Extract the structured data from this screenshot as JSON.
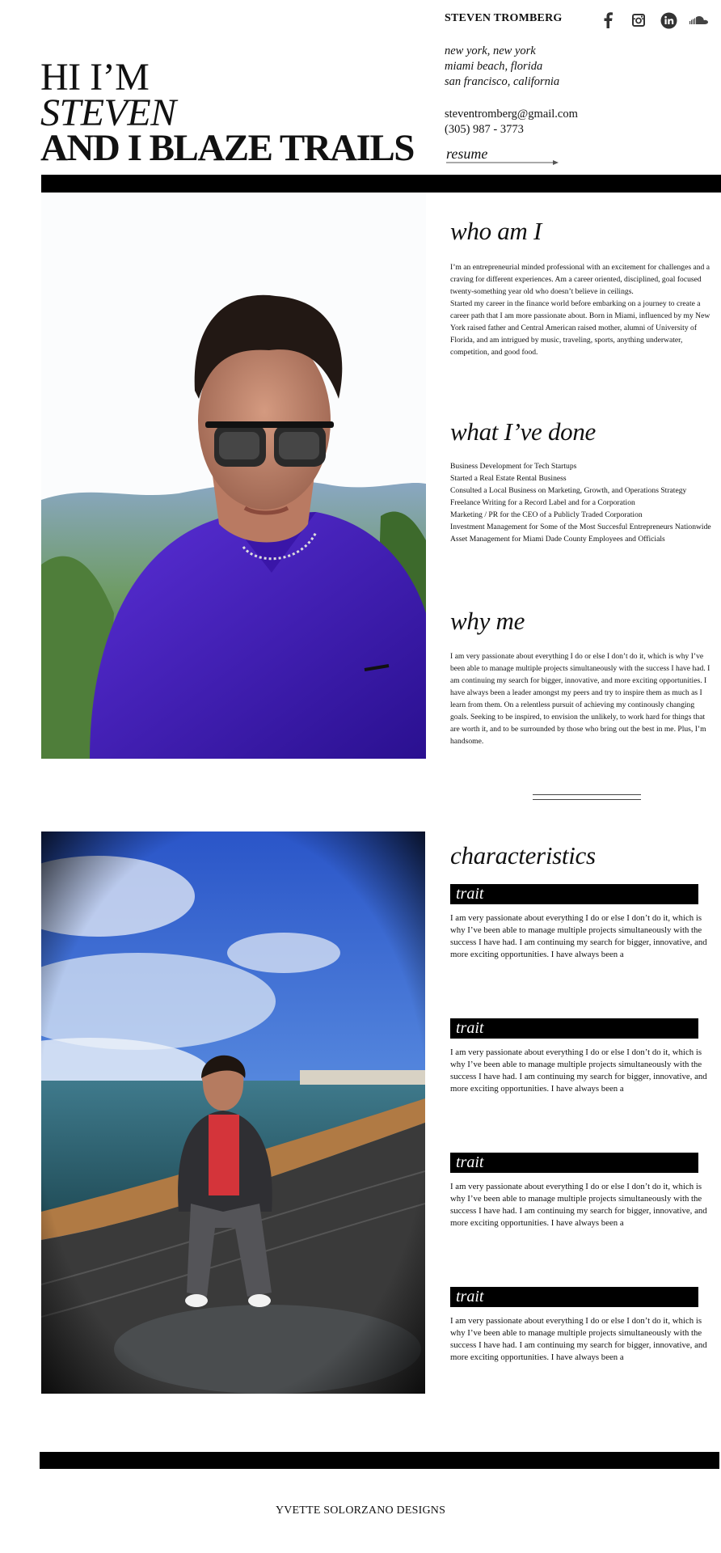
{
  "header": {
    "brand": "STEVEN TROMBERG",
    "social": [
      {
        "icon": "facebook-icon"
      },
      {
        "icon": "instagram-icon"
      },
      {
        "icon": "linkedin-icon"
      },
      {
        "icon": "soundcloud-icon"
      }
    ],
    "locations": [
      "new york, new york",
      "miami beach, florida",
      "san francisco, california"
    ],
    "email": "steventromberg@gmail.com",
    "phone": "(305) 987 - 3773",
    "resume_label": "resume"
  },
  "hero": {
    "line1": "HI I’M",
    "line2": "STEVEN",
    "line3": "AND I BLAZE TRAILS"
  },
  "sections": {
    "who": {
      "title": "who am I",
      "body": "I’m an entrepreneurial minded professional with an excitement for challenges and a craving for different experiences.  Am a career oriented, disciplined, goal focused twenty-something year old who doesn’t believe in ceilings.\nStarted my career in the finance world before embarking on a journey to create a career path that I am more passionate about. Born in Miami, influenced by my New York raised father and Central American raised mother, alumni of University of Florida, and am intrigued by music, traveling, sports, anything underwater, competition, and good food."
    },
    "done": {
      "title": "what I’ve done",
      "items": [
        "Business Development for Tech Startups",
        "Started a Real Estate Rental Business",
        "Consulted a Local Business on Marketing, Growth, and Operations Strategy",
        "Freelance Writing for a Record Label and for a Corporation",
        "Marketing / PR for the CEO of a Publicly Traded Corporation",
        "Investment Management for Some of the Most Succesful Entrepreneurs Nationwide",
        "Asset Management for Miami Dade County Employees and Officials"
      ]
    },
    "why": {
      "title": "why me",
      "body": "I am very passionate about everything I do or else I don’t do it, which is why I’ve been able to manage multiple projects simultaneously with the success I have had. I am continuing my search for bigger, innovative, and more exciting opportunities. I have always been a leader amongst my peers and try to inspire them as much as I learn from them.  On a relentless pursuit of achieving my continously changing goals. Seeking to be inspired, to envision the unlikely, to work hard for things that are worth it, and to be surrounded by those who bring out the best in me. Plus, I’m handsome."
    },
    "characteristics": {
      "title": "characteristics",
      "traits": [
        {
          "label": "trait",
          "text": "I am very passionate about everything I do or else I don’t do it, which is why I’ve been able to manage multiple projects simultaneously with the success I have had. I am continuing my search for bigger, innovative, and more exciting opportunities. I have always been a"
        },
        {
          "label": "trait",
          "text": "I am very passionate about everything I do or else I don’t do it, which is why I’ve been able to manage multiple projects simultaneously with the success I have had. I am continuing my search for bigger, innovative, and more exciting opportunities. I have always been a"
        },
        {
          "label": "trait",
          "text": "I am very passionate about everything I do or else I don’t do it, which is why I’ve been able to manage multiple projects simultaneously with the success I have had. I am continuing my search for bigger, innovative, and more exciting opportunities. I have always been a"
        },
        {
          "label": "trait",
          "text": "I am very passionate about everything I do or else I don’t do it, which is why I’ve been able to manage multiple projects simultaneously with the success I have had. I am continuing my search for bigger, innovative, and more exciting opportunities. I have always been a"
        }
      ]
    }
  },
  "footer": {
    "credit": "YVETTE SOLORZANO DESIGNS"
  },
  "colors": {
    "text": "#111111",
    "bars": "#000000",
    "background": "#ffffff",
    "icon": "#333333"
  }
}
